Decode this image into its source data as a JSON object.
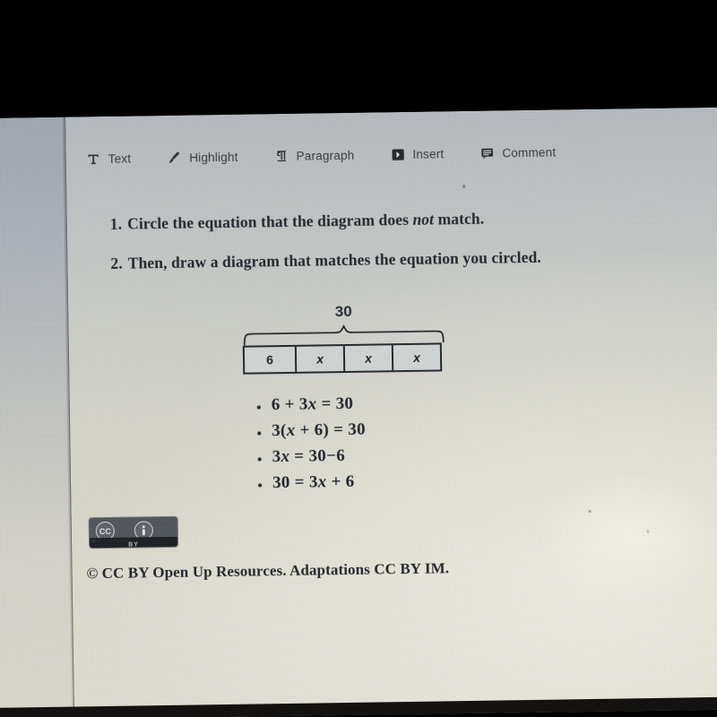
{
  "toolbar": {
    "items": [
      {
        "label": "Text",
        "icon": "text-format-icon"
      },
      {
        "label": "Highlight",
        "icon": "highlighter-pen-icon"
      },
      {
        "label": "Paragraph",
        "icon": "pilcrow-paragraph-icon"
      },
      {
        "label": "Insert",
        "icon": "insert-arrow-icon"
      },
      {
        "label": "Comment",
        "icon": "comment-bubble-icon"
      }
    ]
  },
  "document": {
    "questions": [
      {
        "number": "1.",
        "text_before": "Circle the equation that the diagram does ",
        "emphasis": "not",
        "text_after": " match."
      },
      {
        "number": "2.",
        "text_before": "Then, draw a diagram that matches the equation you circled.",
        "emphasis": "",
        "text_after": ""
      }
    ],
    "diagram": {
      "total_label": "30",
      "cells": [
        "6",
        "x",
        "x",
        "x"
      ]
    },
    "equations": [
      {
        "parts": [
          "6 + 3",
          "x",
          " = 30"
        ]
      },
      {
        "parts": [
          "3(",
          "x",
          " + 6) = 30"
        ]
      },
      {
        "parts": [
          "3",
          "x",
          " = 30−6"
        ]
      },
      {
        "parts": [
          "30 = 3",
          "x",
          " + 6"
        ]
      }
    ],
    "license_badge": {
      "cc_text": "CC",
      "by_text": "BY",
      "attribution_icon": "person-attribution-icon"
    },
    "footer": "© CC BY Open Up Resources. Adaptations CC BY IM."
  },
  "colors": {
    "page_background": "#d3d3c8",
    "rail_background": "#b0b6bd",
    "ink": "#1b1f26",
    "bezel": "#000000"
  }
}
